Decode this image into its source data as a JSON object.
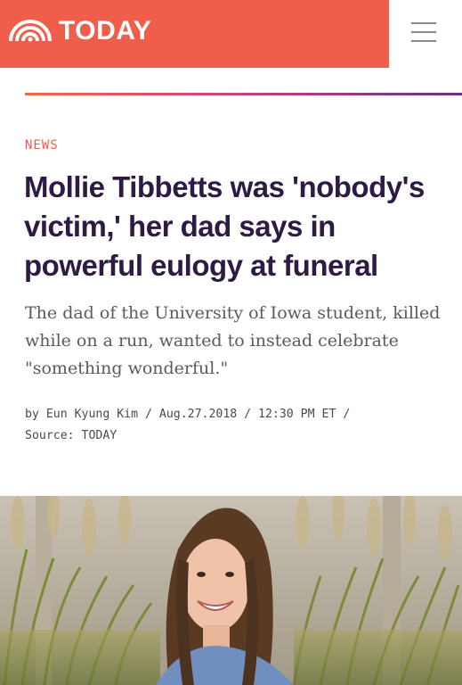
{
  "header": {
    "brand_name": "TODAY",
    "logo_icon": "rainbow-logo-icon",
    "menu_icon": "hamburger-menu-icon",
    "brand_color": "#ef5e4b"
  },
  "article": {
    "category": "NEWS",
    "headline": "Mollie Tibbetts was 'nobody's victim,' her dad says in powerful eulogy at funeral",
    "dek": "The dad of the University of Iowa student, killed while on a run, wanted to instead celebrate \"something wonderful.\"",
    "byline": {
      "author": "by Eun Kyung Kim",
      "separator": " / ",
      "date": "Aug.27.2018",
      "time": "12:30 PM ET",
      "source": "Source: TODAY"
    },
    "colors": {
      "headline": "#2e1a43",
      "category": "#ef5e4b"
    }
  }
}
